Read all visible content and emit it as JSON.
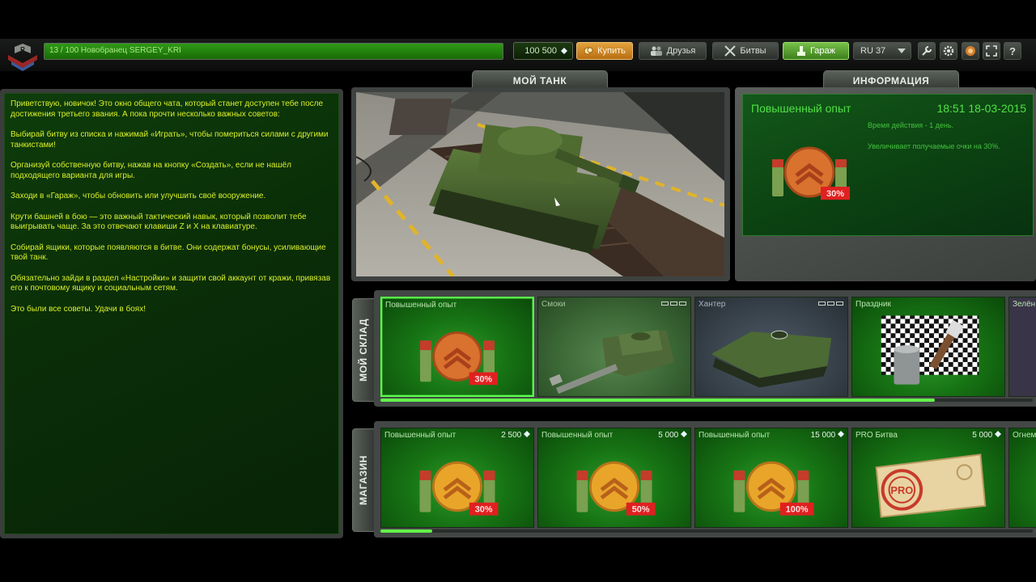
{
  "topbar": {
    "xp_text": "13 / 100   Новобранец SERGEY_KRI",
    "xp_progress": 1.0,
    "crystals": "100 500",
    "buy_label": "Купить",
    "friends_label": "Друзья",
    "battles_label": "Битвы",
    "garage_label": "Гараж",
    "server_label": "RU 37",
    "icons": [
      "settings-wrench-icon",
      "gear-icon",
      "sound-icon",
      "fullscreen-icon",
      "help-icon"
    ],
    "help_glyph": "?"
  },
  "tabs": {
    "my_tank": "МОЙ ТАНК",
    "info": "ИНФОРМАЦИЯ"
  },
  "chat": {
    "messages": [
      "Приветствую, новичок! Это окно общего чата, который станет доступен тебе после достижения третьего звания. А пока прочти несколько важных советов:",
      "Выбирай битву из списка и нажимай «Играть», чтобы помериться силами с другими танкистами!",
      "Организуй собственную битву, нажав на кнопку «Создать», если не нашёл подходящего варианта для игры.",
      "Заходи в «Гараж», чтобы обновить или улучшить своё вооружение.",
      "Крути башней в бою — это важный тактический навык, который позволит тебе выигрывать чаще. За это отвечают клавиши Z и X на клавиатуре.",
      "Собирай ящики, которые появляются в битве. Они содержат бонусы, усиливающие твой танк.",
      "Обязательно зайди в раздел «Настройки» и защити свой аккаунт от кражи, привязав его к почтовому ящику и социальным сетям.",
      "Это были все советы. Удачи в боях!"
    ]
  },
  "info": {
    "title": "Повышенный опыт",
    "time": "18:51  18-03-2015",
    "duration": "Время действия - 1 день.",
    "description": "Увеличивает получаемые очки на 30%.",
    "badge": "30%"
  },
  "warehouse": {
    "label": "МОЙ СКЛАД",
    "items": [
      {
        "name": "Повышенный опыт",
        "badge": "30%",
        "style": "green",
        "selected": true
      },
      {
        "name": "Смоки",
        "style": "dim",
        "selected": false
      },
      {
        "name": "Хантер",
        "style": "slate",
        "selected": false
      },
      {
        "name": "Праздник",
        "style": "green",
        "selected": false
      },
      {
        "name": "Зелён",
        "style": "purple",
        "selected": false
      }
    ],
    "scroll_fraction": 0.85
  },
  "shop": {
    "label": "МАГАЗИН",
    "items": [
      {
        "name": "Повышенный опыт",
        "price": "2 500",
        "badge": "30%"
      },
      {
        "name": "Повышенный опыт",
        "price": "5 000",
        "badge": "50%"
      },
      {
        "name": "Повышенный опыт",
        "price": "15 000",
        "badge": "100%"
      },
      {
        "name": "PRO Битва",
        "price": "5 000",
        "stamp": "PRO"
      },
      {
        "name": "Огнем"
      }
    ],
    "scroll_fraction": 0.08
  },
  "colors": {
    "chat_text": "#d9f02a",
    "info_text": "#52e046",
    "accent_green": "#63f24a",
    "buy_orange": "#e3a23c",
    "badge_red": "#e02020"
  }
}
